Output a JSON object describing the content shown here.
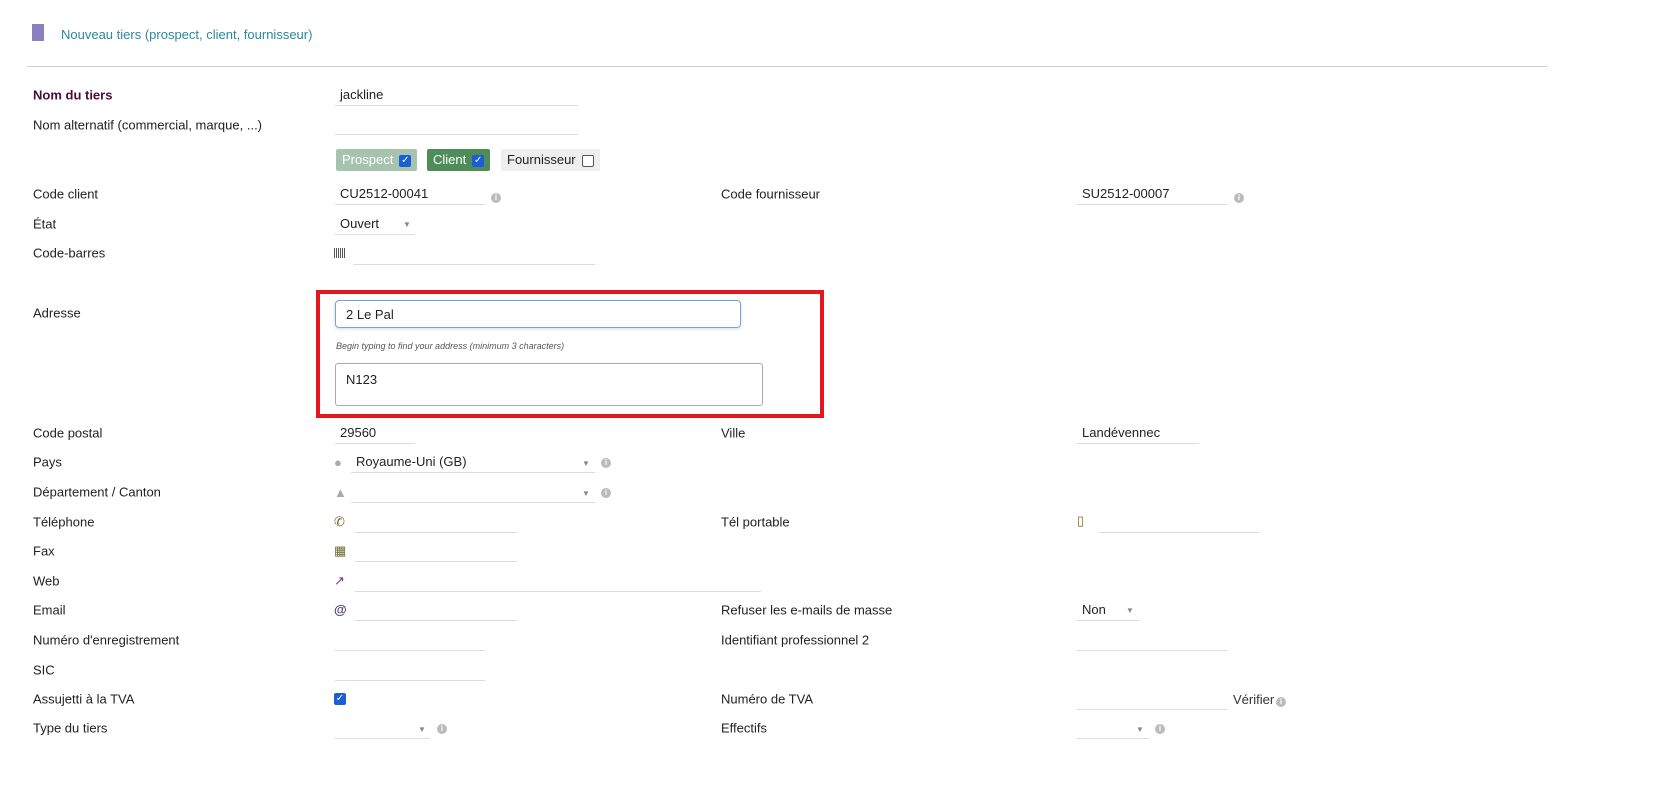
{
  "header": {
    "title": "Nouveau tiers (prospect, client, fournisseur)",
    "icon": "building-icon"
  },
  "form": {
    "name_label": "Nom du tiers",
    "name_value": "jackline",
    "alt_name_label": "Nom alternatif (commercial, marque, ...)",
    "alt_name_value": "",
    "types": {
      "prospect": "Prospect",
      "client": "Client",
      "supplier": "Fournisseur"
    },
    "customer_code_label": "Code client",
    "customer_code": "CU2512-00041",
    "supplier_code_label": "Code fournisseur",
    "supplier_code": "SU2512-00007",
    "state_label": "État",
    "state_value": "Ouvert",
    "barcode_label": "Code-barres",
    "address_label": "Adresse",
    "address_value": "2 Le Pal",
    "address_hint": "Begin typing to find your address (minimum 3 characters)",
    "address_line2": "N123",
    "zip_label": "Code postal",
    "zip_value": "29560",
    "town_label": "Ville",
    "town_value": "Landévennec",
    "country_label": "Pays",
    "country_value": "Royaume-Uni (GB)",
    "state_province_label": "Département / Canton",
    "phone_label": "Téléphone",
    "mobile_label": "Tél portable",
    "fax_label": "Fax",
    "web_label": "Web",
    "email_label": "Email",
    "no_email_label": "Refuser les e-mails de masse",
    "no_email_value": "Non",
    "reg_label": "Numéro d'enregistrement",
    "prof2_label": "Identifiant professionnel 2",
    "sic_label": "SIC",
    "vat_subject_label": "Assujetti à la TVA",
    "vat_number_label": "Numéro de TVA",
    "verify_label": "Vérifier",
    "type_label": "Type du tiers",
    "staff_label": "Effectifs"
  },
  "colors": {
    "accent": "#2a8a9a",
    "highlight": "#e5161f",
    "client": "#4e8c5a",
    "prospect": "#a6c4ad"
  }
}
